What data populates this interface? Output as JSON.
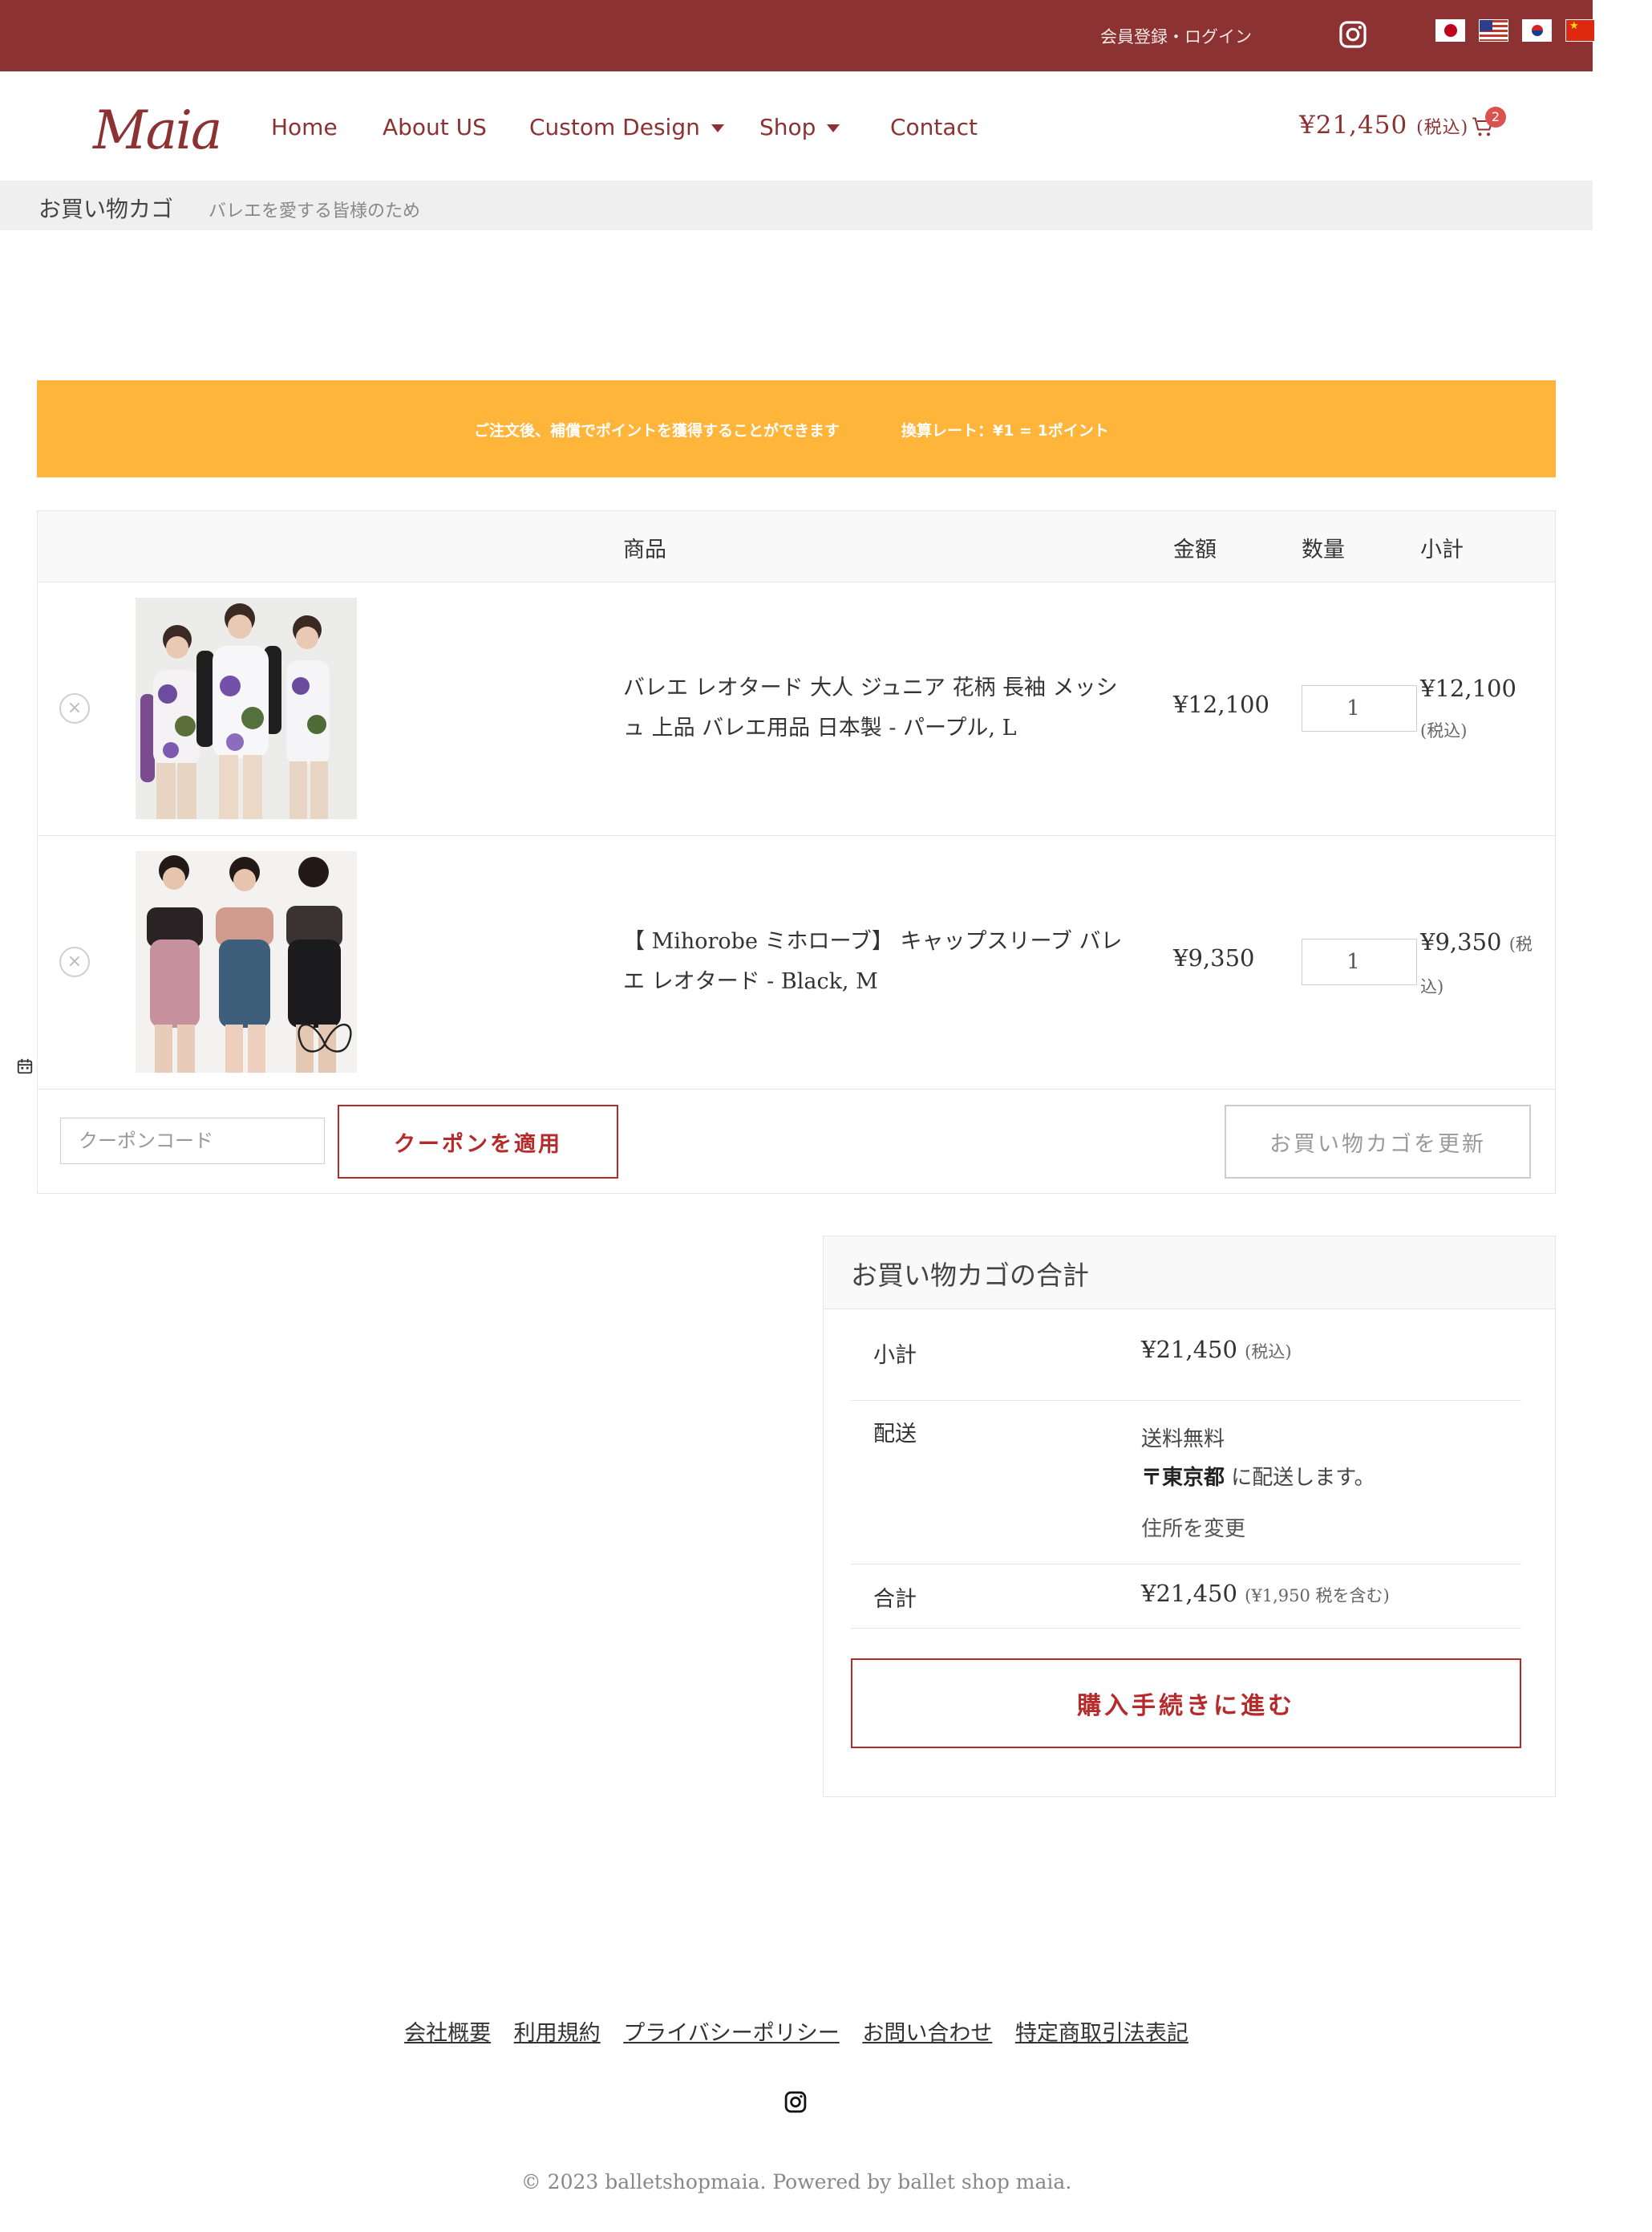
{
  "topbar": {
    "login_label": "会員登録・ログイン",
    "instagram_icon": "instagram-icon",
    "languages": [
      "日本語",
      "English",
      "한국어",
      "中文"
    ],
    "bg_color": "#8c3232"
  },
  "header": {
    "logo": "Maia",
    "nav": [
      {
        "label": "Home",
        "dropdown": false
      },
      {
        "label": "About US",
        "dropdown": false
      },
      {
        "label": "Custom Design",
        "dropdown": true
      },
      {
        "label": "Shop",
        "dropdown": true
      },
      {
        "label": "Contact",
        "dropdown": false
      }
    ],
    "cart_total": "¥21,450",
    "cart_tax": "(税込)",
    "cart_count": "2"
  },
  "page": {
    "title": "お買い物カゴ",
    "subtitle": "バレエを愛する皆様のため"
  },
  "notice": {
    "message": "ご注文後、補償でポイントを獲得することができます",
    "rate": "換算レート：¥1 = 1ポイント",
    "color": "#ffb43a"
  },
  "cart": {
    "headers": {
      "product": "商品",
      "price": "金額",
      "quantity": "数量",
      "subtotal": "小計"
    },
    "items": [
      {
        "name": "バレエ レオタード 大人 ジュニア 花柄 長袖 メッシュ 上品 バレエ用品 日本製 - パープル, L",
        "price": "¥12,100",
        "quantity": "1",
        "subtotal": "¥12,100",
        "subtotal_tax": "(税込)",
        "image": "floral-leotards-photo"
      },
      {
        "name": "【 Mihorobe ミホローブ】 キャップスリーブ バレエ レオタード - Black, M",
        "price": "¥9,350",
        "quantity": "1",
        "subtotal": "¥9,350",
        "subtotal_tax": "(税込)",
        "image": "cap-sleeve-leotards-photo"
      }
    ],
    "coupon_placeholder": "クーポンコード",
    "apply_coupon": "クーポンを適用",
    "update_cart": "お買い物カゴを更新"
  },
  "totals": {
    "title": "お買い物カゴの合計",
    "subtotal_label": "小計",
    "subtotal_value": "¥21,450",
    "subtotal_tax": "(税込)",
    "shipping_label": "配送",
    "shipping_free": "送料無料",
    "shipping_dest_prefix": "〒東京都",
    "shipping_dest_suffix": " に配送します。",
    "change_address": "住所を変更",
    "total_label": "合計",
    "total_value": "¥21,450",
    "total_tax": "(¥1,950 税を含む)",
    "checkout": "購入手続きに進む"
  },
  "footer": {
    "links": [
      "会社概要",
      "利用規約",
      "プライバシーポリシー",
      "お問い合わせ",
      "特定商取引法表記"
    ],
    "copyright": "© 2023 balletshopmaia. Powered by ballet shop maia."
  },
  "colors": {
    "brand": "#8c3232",
    "accent": "#b52b2b",
    "notice": "#ffb43a"
  }
}
